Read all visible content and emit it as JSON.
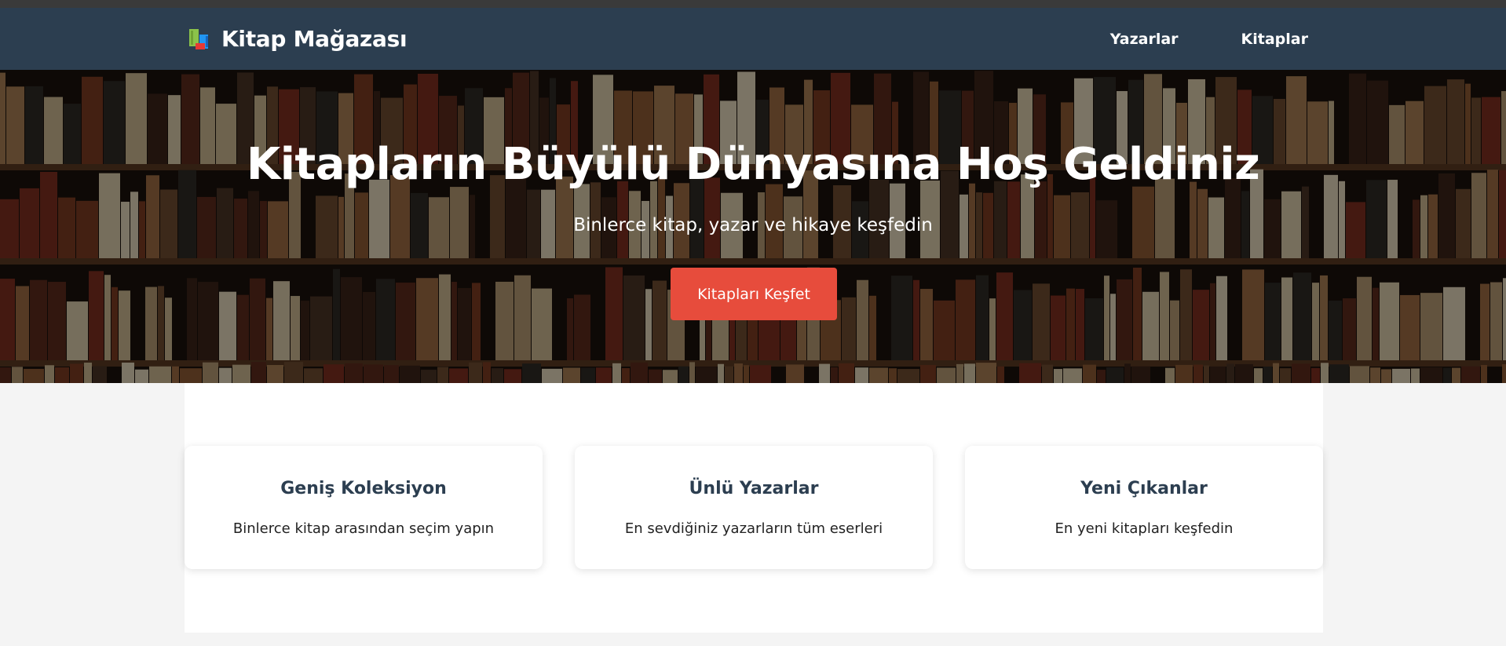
{
  "header": {
    "brand_icon": "books-icon",
    "brand_name": "Kitap Mağazası",
    "nav": [
      {
        "label": "Yazarlar"
      },
      {
        "label": "Kitaplar"
      }
    ]
  },
  "hero": {
    "background": "bookshelf-photo",
    "title": "Kitapların Büyülü Dünyasına Hoş Geldiniz",
    "subtitle": "Binlerce kitap, yazar ve hikaye keşfedin",
    "cta_label": "Kitapları Keşfet"
  },
  "features": [
    {
      "title": "Geniş Koleksiyon",
      "description": "Binlerce kitap arasından seçim yapın"
    },
    {
      "title": "Ünlü Yazarlar",
      "description": "En sevdiğiniz yazarların tüm eserleri"
    },
    {
      "title": "Yeni Çıkanlar",
      "description": "En yeni kitapları keşfedin"
    }
  ],
  "colors": {
    "navbar": "#2c3e50",
    "accent": "#e74c3c",
    "card_title": "#2c3e50",
    "page_bg": "#f4f4f4"
  }
}
